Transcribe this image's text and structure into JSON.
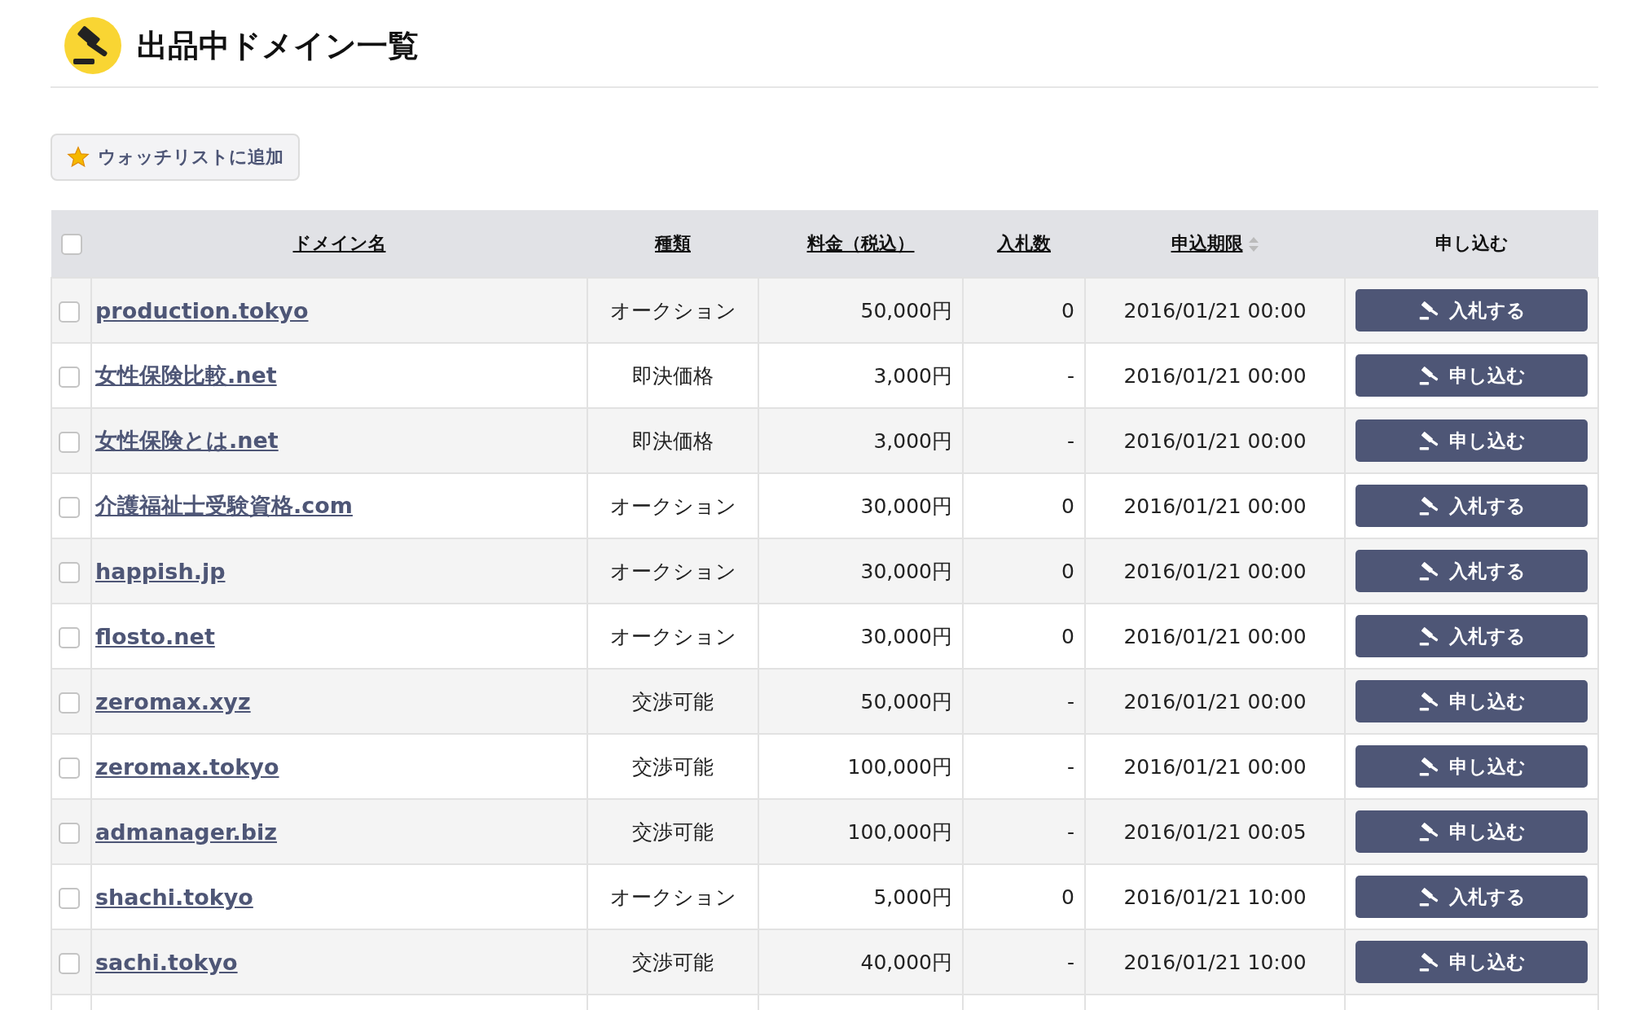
{
  "page_title": "出品中ドメイン一覧",
  "watchlist_button": "ウォッチリストに追加",
  "table": {
    "select_all_checked": false,
    "columns": [
      {
        "label": "ドメイン名",
        "sortable": true,
        "sort_indicator": false
      },
      {
        "label": "種類",
        "sortable": true,
        "sort_indicator": false
      },
      {
        "label": "料金（税込）",
        "sortable": true,
        "sort_indicator": false
      },
      {
        "label": "入札数",
        "sortable": true,
        "sort_indicator": false
      },
      {
        "label": "申込期限",
        "sortable": true,
        "sort_indicator": true
      },
      {
        "label": "申し込む",
        "sortable": false,
        "sort_indicator": false
      }
    ],
    "rows": [
      {
        "checked": false,
        "domain": "production.tokyo",
        "type": "オークション",
        "price": "50,000円",
        "bids": "0",
        "deadline": "2016/01/21 00:00",
        "action": "入札する"
      },
      {
        "checked": false,
        "domain": "女性保険比較.net",
        "type": "即決価格",
        "price": "3,000円",
        "bids": "-",
        "deadline": "2016/01/21 00:00",
        "action": "申し込む"
      },
      {
        "checked": false,
        "domain": "女性保険とは.net",
        "type": "即決価格",
        "price": "3,000円",
        "bids": "-",
        "deadline": "2016/01/21 00:00",
        "action": "申し込む"
      },
      {
        "checked": false,
        "domain": "介護福祉士受験資格.com",
        "type": "オークション",
        "price": "30,000円",
        "bids": "0",
        "deadline": "2016/01/21 00:00",
        "action": "入札する"
      },
      {
        "checked": false,
        "domain": "happish.jp",
        "type": "オークション",
        "price": "30,000円",
        "bids": "0",
        "deadline": "2016/01/21 00:00",
        "action": "入札する"
      },
      {
        "checked": false,
        "domain": "flosto.net",
        "type": "オークション",
        "price": "30,000円",
        "bids": "0",
        "deadline": "2016/01/21 00:00",
        "action": "入札する"
      },
      {
        "checked": false,
        "domain": "zeromax.xyz",
        "type": "交渉可能",
        "price": "50,000円",
        "bids": "-",
        "deadline": "2016/01/21 00:00",
        "action": "申し込む"
      },
      {
        "checked": false,
        "domain": "zeromax.tokyo",
        "type": "交渉可能",
        "price": "100,000円",
        "bids": "-",
        "deadline": "2016/01/21 00:00",
        "action": "申し込む"
      },
      {
        "checked": false,
        "domain": "admanager.biz",
        "type": "交渉可能",
        "price": "100,000円",
        "bids": "-",
        "deadline": "2016/01/21 00:05",
        "action": "申し込む"
      },
      {
        "checked": false,
        "domain": "shachi.tokyo",
        "type": "オークション",
        "price": "5,000円",
        "bids": "0",
        "deadline": "2016/01/21 10:00",
        "action": "入札する"
      },
      {
        "checked": false,
        "domain": "sachi.tokyo",
        "type": "交渉可能",
        "price": "40,000円",
        "bids": "-",
        "deadline": "2016/01/21 10:00",
        "action": "申し込む"
      }
    ]
  }
}
